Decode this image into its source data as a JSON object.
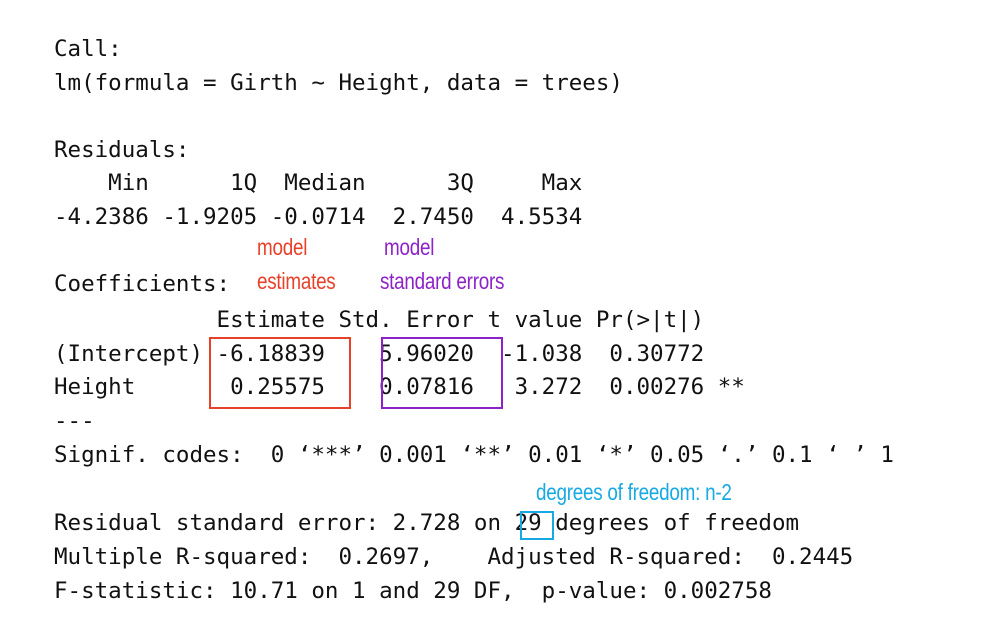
{
  "output": {
    "call_label": "Call:",
    "call": "lm(formula = Girth ~ Height, data = trees)",
    "residuals_label": "Residuals:",
    "residuals_header": "    Min      1Q  Median      3Q     Max ",
    "residuals_values": "-4.2386 -1.9205 -0.0714  2.7450  4.5534 ",
    "coefficients_label": "Coefficients:",
    "coef_header": "            Estimate Std. Error t value Pr(>|t|)",
    "coef_intercept": "(Intercept) -6.18839    5.96020  -1.038  0.30772",
    "coef_height": "Height       0.25575    0.07816   3.272  0.00276 **",
    "separator": "---",
    "signif": "Signif. codes:  0 ‘***’ 0.001 ‘**’ 0.01 ‘*’ 0.05 ‘.’ 0.1 ‘ ’ 1",
    "rse": "Residual standard error: 2.728 on 29 degrees of freedom",
    "r_squared": "Multiple R-squared:  0.2697,\tAdjusted R-squared:  0.2445 ",
    "f_stat": "F-statistic: 10.71 on 1 and 29 DF,  p-value: 0.002758"
  },
  "annotations": {
    "estimates_line1": "model",
    "estimates_line2": "estimates",
    "se_line1": "model",
    "se_line2": "standard errors",
    "df_note": "degrees of freedom: n-2"
  },
  "colors": {
    "estimates": "#e8412a",
    "standard_errors": "#8e22c9",
    "degrees_of_freedom": "#17a9e3"
  }
}
